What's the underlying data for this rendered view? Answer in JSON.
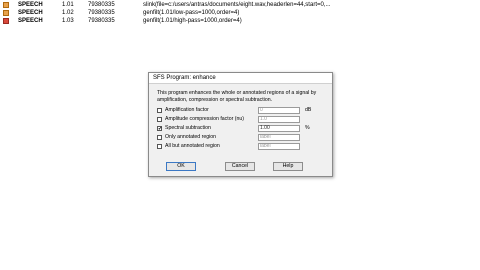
{
  "list": {
    "rows": [
      {
        "name": "SPEECH",
        "version": "1.01",
        "date": "79380335",
        "command": "slink(file=c:/users/antras/documents/eight.wav,headerlen=44,start=0,...",
        "icon_color": "#e8a24c"
      },
      {
        "name": "SPEECH",
        "version": "1.02",
        "date": "79380335",
        "command": "genfilt(1.01/low-pass=1000,order=4)",
        "icon_color": "#e8a24c"
      },
      {
        "name": "SPEECH",
        "version": "1.03",
        "date": "79380335",
        "command": "genfilt(1.01/high-pass=1000,order=4)",
        "icon_color": "#d9483b"
      }
    ]
  },
  "dialog": {
    "title": "SFS Program: enhance",
    "description": "This program enhances the whole or annotated regions of a signal by amplification, compression or spectral subtraction.",
    "options": [
      {
        "label": "Amplification factor",
        "checked": false,
        "value": "0",
        "unit": "dB",
        "value_muted": true
      },
      {
        "label": "Amplitude compression factor (nu)",
        "checked": false,
        "value": "1.0",
        "unit": "",
        "value_muted": true
      },
      {
        "label": "Spectral subtraction",
        "checked": true,
        "value": "1.00",
        "unit": "%",
        "value_muted": false
      },
      {
        "label": "Only annotated region",
        "checked": false,
        "value": "label",
        "unit": "",
        "value_muted": true
      },
      {
        "label": "All but annotated region",
        "checked": false,
        "value": "label",
        "unit": "",
        "value_muted": true
      }
    ],
    "buttons": {
      "ok": "OK",
      "cancel": "Cancel",
      "help": "Help"
    },
    "check_mark": "✔"
  }
}
